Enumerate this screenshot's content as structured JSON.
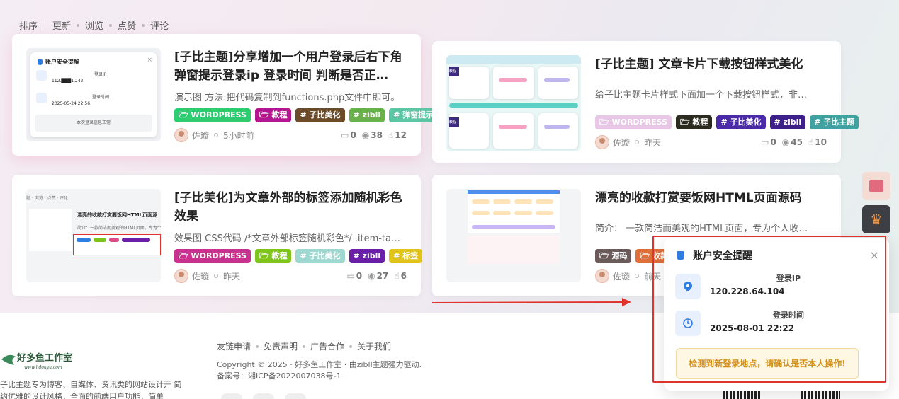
{
  "sortbar": {
    "items": [
      "排序",
      "更新",
      "浏览",
      "点赞",
      "评论"
    ]
  },
  "posts": [
    {
      "title": "[子比主题]分享增加一个用户登录后右下角弹窗提示登录ip 登录时间 判断是否正…",
      "excerpt": "演示图 方法:把代码复制到functions.php文件中即可。",
      "tags": [
        {
          "label": "WORDPRESS",
          "color": "#2ecc71"
        },
        {
          "label": "教程",
          "color": "#b5158f"
        },
        {
          "label": "子比美化",
          "color": "#6b4a2a"
        },
        {
          "label": "zibll",
          "color": "#6ab04c"
        },
        {
          "label": "弹窗提示",
          "color": "#5cc6a4"
        }
      ],
      "author": "佐璇",
      "time": "5小时前",
      "comments": "0",
      "views": "38",
      "likes": "12",
      "thumb": {
        "title": "账户安全提醒",
        "ip_label": "登录IP",
        "ip_value": "112.███1.242",
        "time_label": "登录时间",
        "time_value": "2025-05-24 22:56",
        "notice": "本次登录信息正常"
      }
    },
    {
      "title": "[子比主题] 文章卡片下载按钮样式美化",
      "excerpt": "给子比主题卡片样式下面加一个下载按钮样式，非…",
      "tags": [
        {
          "label": "WORDPRESS",
          "color": "#e8c6e6"
        },
        {
          "label": "教程",
          "color": "#2b2b1f"
        },
        {
          "label": "子比美化",
          "color": "#4b2aa8"
        },
        {
          "label": "zibll",
          "color": "#3d1f8a"
        },
        {
          "label": "子比主题",
          "color": "#3fa2a0"
        }
      ],
      "author": "佐璇",
      "time": "昨天",
      "comments": "0",
      "views": "45",
      "likes": "10",
      "thumb": {
        "label_a": "教程",
        "label_b": "教程"
      }
    },
    {
      "title": "[子比美化]为文章外部的标签添加随机彩色效果",
      "excerpt": "效果图 CSS代码 /*文章外部标签随机彩色*/ .item-ta…",
      "tags": [
        {
          "label": "WORDPRESS",
          "color": "#c8318f"
        },
        {
          "label": "教程",
          "color": "#7fc41a"
        },
        {
          "label": "子比美化",
          "color": "#9fd8d1"
        },
        {
          "label": "zibll",
          "color": "#6b1fa8"
        },
        {
          "label": "标签",
          "color": "#e0c31a"
        }
      ],
      "author": "佐璇",
      "time": "昨天",
      "comments": "0",
      "views": "27",
      "likes": "6",
      "thumb": {
        "crumbs": "题  ·  浏览  ·  点赞  ·  评论",
        "heading": "漂亮的收款打赏要饭网HTML页面源",
        "intro": "简介：一款简洁而美观的HTML页面，专为个"
      }
    },
    {
      "title": "漂亮的收款打赏要饭网HTML页面源码",
      "excerpt": "简介： 一款简洁而美观的HTML页面，专为个人收…",
      "tags": [
        {
          "label": "源码",
          "color": "#6a5a5a"
        },
        {
          "label": "收款",
          "color": "#e0703a"
        }
      ],
      "author": "佐璇",
      "time": "前天",
      "comments": "",
      "views": "",
      "likes": ""
    }
  ],
  "popup": {
    "title": "账户安全提醒",
    "ip_label": "登录IP",
    "ip_value": "120.228.64.104",
    "time_label": "登录时间",
    "time_value": "2025-08-01 22:22",
    "warning": "检测到新登录地点，请确认是否本人操作!",
    "close": "×"
  },
  "footer": {
    "links": [
      "友链申请",
      "免责声明",
      "广告合作",
      "关于我们"
    ],
    "copyright": "Copyright © 2025 · 好多鱼工作室 · 由zibll主题强力驱动.",
    "icp": "备案号：湘ICP备2022007038号-1",
    "logo_text": "好多鱼工作室",
    "logo_url": "www.hdouyu.com",
    "desc": "子比主题专为博客、自媒体、资讯类的网站设计开 简约优雅的设计风格，全面的前端用户功能，简单"
  },
  "colors": {
    "accent_red": "#e0332e",
    "popup_icon_blue": "#2f7de1",
    "warn_text": "#d4901a"
  }
}
